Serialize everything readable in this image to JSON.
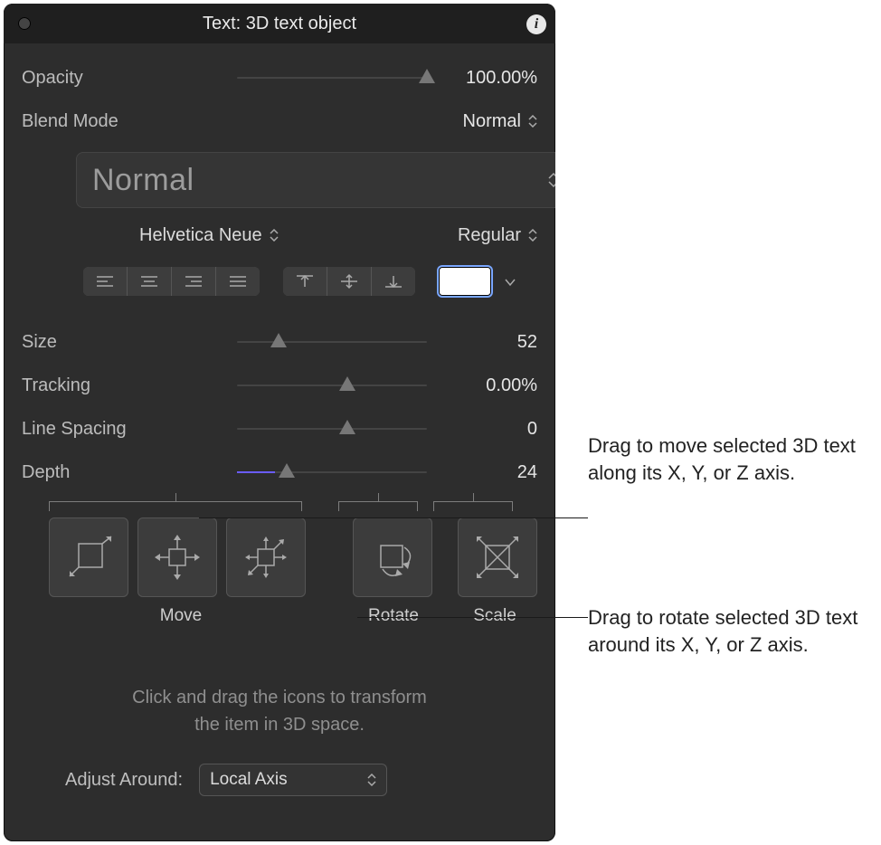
{
  "panel": {
    "title": "Text: 3D text  object",
    "opacity": {
      "label": "Opacity",
      "value": "100.00%",
      "thumb_pct": 100
    },
    "blend_mode": {
      "label": "Blend Mode",
      "value": "Normal"
    },
    "style_popup": {
      "value": "Normal"
    },
    "font": {
      "family": "Helvetica Neue",
      "weight": "Regular"
    },
    "size": {
      "label": "Size",
      "value": "52",
      "thumb_pct": 22
    },
    "tracking": {
      "label": "Tracking",
      "value": "0.00%",
      "thumb_pct": 58
    },
    "line_spacing": {
      "label": "Line Spacing",
      "value": "0",
      "thumb_pct": 58
    },
    "depth": {
      "label": "Depth",
      "value": "24",
      "thumb_pct": 26,
      "fill_pct": 20
    },
    "color_swatch": "#ffffff",
    "tool_labels": {
      "move": "Move",
      "rotate": "Rotate",
      "scale": "Scale"
    },
    "hint_line1": "Click and drag the icons to transform",
    "hint_line2": "the item in 3D space.",
    "adjust_around": {
      "label": "Adjust Around:",
      "value": "Local Axis"
    }
  },
  "callouts": {
    "move": "Drag to move selected 3D text along its X, Y, or Z axis.",
    "rotate": "Drag to rotate selected 3D text around its X, Y, or Z axis."
  }
}
